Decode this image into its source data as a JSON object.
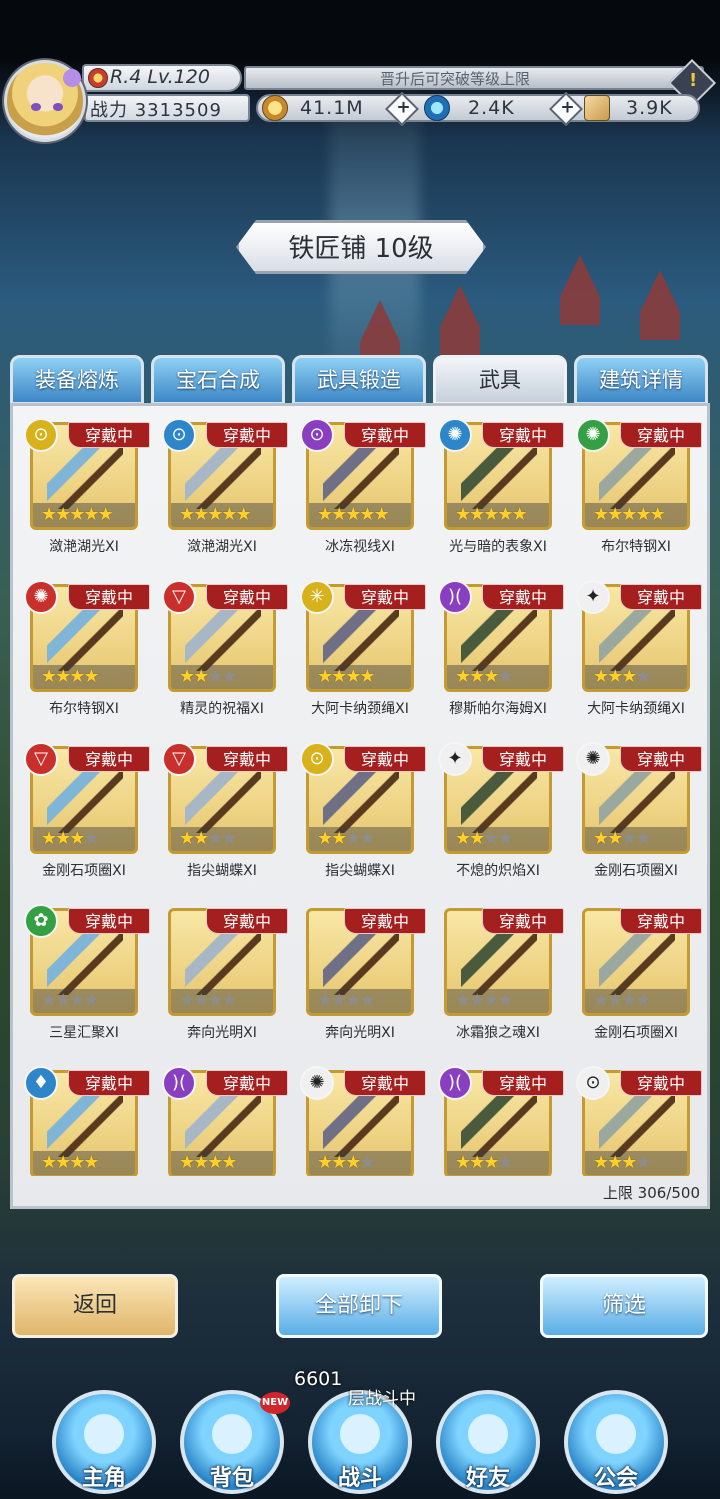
{
  "player": {
    "rank_level": "R.4 Lv.120",
    "power_label": "战力",
    "power_value": "3313509",
    "notice": "晋升后可突破等级上限"
  },
  "resources": [
    {
      "name": "gold",
      "icon": "gold-coin-icon",
      "value": "41.1M"
    },
    {
      "name": "diamond",
      "icon": "blue-diamond-icon",
      "value": "2.4K"
    },
    {
      "name": "scroll",
      "icon": "scroll-icon",
      "value": "3.9K"
    }
  ],
  "title": "铁匠铺 10级",
  "tabs": [
    {
      "label": "装备熔炼",
      "active": false
    },
    {
      "label": "宝石合成",
      "active": false
    },
    {
      "label": "武具锻造",
      "active": false
    },
    {
      "label": "武具",
      "active": true
    },
    {
      "label": "建筑详情",
      "active": false
    }
  ],
  "equipped_label": "穿戴中",
  "items": [
    {
      "name": "潋滟湖光XI",
      "element": "magnifier-yellow",
      "stars": 5,
      "max": 5
    },
    {
      "name": "潋滟湖光XI",
      "element": "magnifier-blue",
      "stars": 5,
      "max": 5
    },
    {
      "name": "冰冻视线XI",
      "element": "magnifier-purple",
      "stars": 5,
      "max": 5
    },
    {
      "name": "光与暗的表象XI",
      "element": "swirl-blue",
      "stars": 5,
      "max": 5
    },
    {
      "name": "布尔特钢XI",
      "element": "swirl-green",
      "stars": 5,
      "max": 5
    },
    {
      "name": "布尔特钢XI",
      "element": "swirl-red",
      "stars": 4,
      "max": 4
    },
    {
      "name": "精灵的祝福XI",
      "element": "triangle-red",
      "stars": 2,
      "max": 4
    },
    {
      "name": "大阿卡纳颈绳XI",
      "element": "sun-yellow",
      "stars": 4,
      "max": 4
    },
    {
      "name": "穆斯帕尔海姆XI",
      "element": "moon-purple",
      "stars": 3,
      "max": 4
    },
    {
      "name": "大阿卡纳颈绳XI",
      "element": "shuriken-white",
      "stars": 3,
      "max": 4
    },
    {
      "name": "金刚石项圈XI",
      "element": "triangle-red",
      "stars": 3,
      "max": 4
    },
    {
      "name": "指尖蝴蝶XI",
      "element": "triangle-red",
      "stars": 2,
      "max": 4
    },
    {
      "name": "指尖蝴蝶XI",
      "element": "magnifier-yellow",
      "stars": 2,
      "max": 4
    },
    {
      "name": "不熄的炽焰XI",
      "element": "shuriken-white",
      "stars": 2,
      "max": 4
    },
    {
      "name": "金刚石项圈XI",
      "element": "swirl-white",
      "stars": 2,
      "max": 4
    },
    {
      "name": "三星汇聚XI",
      "element": "leaf-green",
      "stars": 0,
      "max": 4
    },
    {
      "name": "奔向光明XI",
      "element": "none",
      "stars": 0,
      "max": 4
    },
    {
      "name": "奔向光明XI",
      "element": "none",
      "stars": 0,
      "max": 4
    },
    {
      "name": "冰霜狼之魂XI",
      "element": "none",
      "stars": 0,
      "max": 4
    },
    {
      "name": "金刚石项圈XI",
      "element": "none",
      "stars": 0,
      "max": 4
    },
    {
      "name": "",
      "element": "drop-blue",
      "stars": 4,
      "max": 4
    },
    {
      "name": "",
      "element": "moon-purple",
      "stars": 4,
      "max": 4
    },
    {
      "name": "",
      "element": "swirl-white",
      "stars": 3,
      "max": 4
    },
    {
      "name": "",
      "element": "moon-purple",
      "stars": 3,
      "max": 4
    },
    {
      "name": "",
      "element": "magnifier-white",
      "stars": 3,
      "max": 4
    }
  ],
  "limit": "上限 306/500",
  "buttons": {
    "back": "返回",
    "unequip_all": "全部卸下",
    "filter": "筛选"
  },
  "battle": {
    "floor": "6601",
    "status": "层战斗中"
  },
  "nav": [
    {
      "label": "主角",
      "icon": "knight-helmet-icon"
    },
    {
      "label": "背包",
      "icon": "backpack-icon",
      "badge": "NEW"
    },
    {
      "label": "战斗",
      "icon": "crossed-swords-icon"
    },
    {
      "label": "好友",
      "icon": "handshake-icon"
    },
    {
      "label": "公会",
      "icon": "guild-emblem-icon"
    }
  ],
  "colors": {
    "equipped_badge": "#a51f1f",
    "tab_blue": "#3d87c6",
    "card_gold": "#e6c56d",
    "star_on": "#ffcf2a"
  }
}
